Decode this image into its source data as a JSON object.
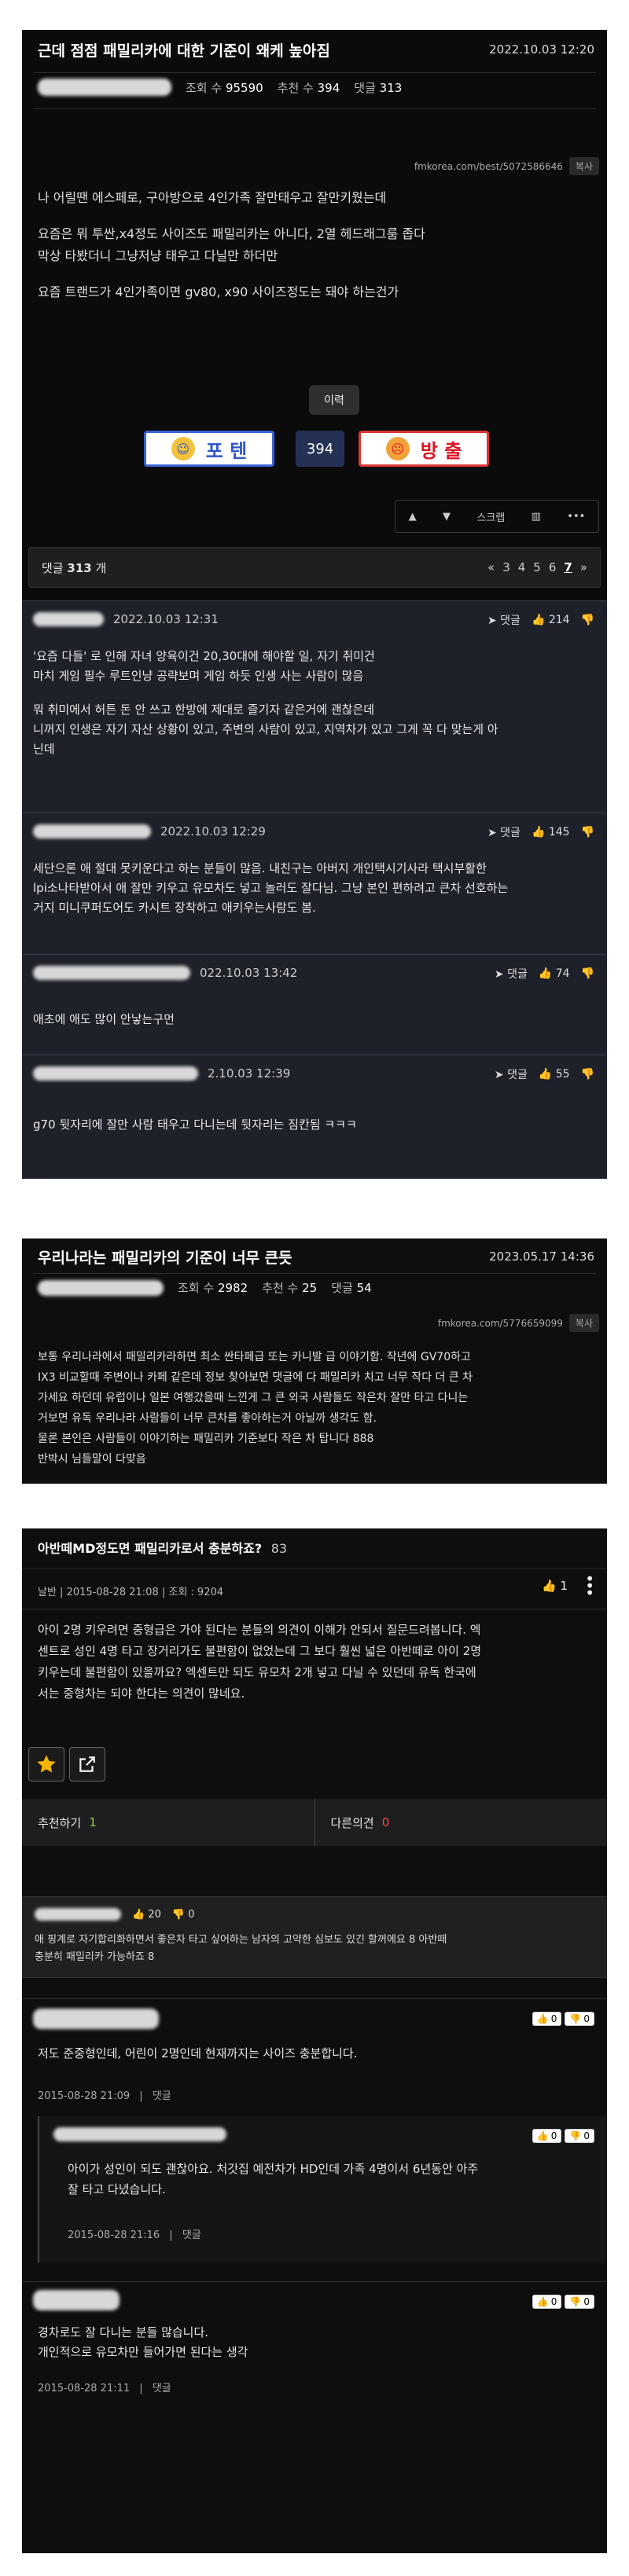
{
  "post1": {
    "title": "근데 점점 패밀리카에 대한 기준이 왜케 높아짐",
    "date": "2022.10.03 12:20",
    "views_label": "조회 수",
    "views": "95590",
    "likes_label": "추천 수",
    "likes": "394",
    "comments_label": "댓글",
    "comments": "313",
    "url": "fmkorea.com/best/5072586646",
    "copy_label": "복사",
    "body": [
      "나 어릴땐 에스페로, 구아방으로 4인가족 잘만태우고 잘만키웠는데",
      "",
      "요즘은 뭐 투싼,x4정도 사이즈도 패밀리카는 아니다, 2열 헤드래그룸 좁다",
      "막상 타봤더니 그냥저냥 태우고 다닐만 하더만",
      "",
      "요즘 트랜드가 4인가족이면 gv80, x90 사이즈정도는 돼야 하는건가"
    ],
    "history_label": "이력",
    "vote_up_label": "포 텐",
    "vote_count": "394",
    "vote_down_label": "방 출",
    "toolbar": {
      "scrap_label": "스크랩"
    },
    "comment_bar": {
      "label": "댓글",
      "count": "313",
      "unit": "개",
      "pages": [
        "3",
        "4",
        "5",
        "6",
        "7"
      ],
      "current_page": "7"
    },
    "comments_list": [
      {
        "date": "2022.10.03 12:31",
        "reply_label": "댓글",
        "likes": "214",
        "text": [
          "'요즘 다들' 로 인해 자녀 양육이건 20,30대에 해야할 일, 자기 취미건",
          "마치 게임 필수 루트인냥 공략보며 게임 하듯 인생 사는 사람이 많음",
          "",
          "뭐 취미에서 허튼 돈 안 쓰고 한방에 제대로 즐기자 같은거에 괜찮은데",
          "니꺼지 인생은 자기 자산 상황이 있고, 주변의 사람이 있고, 지역차가 있고 그게 꼭 다 맞는게 아",
          "닌데"
        ]
      },
      {
        "date": "2022.10.03 12:29",
        "reply_label": "댓글",
        "likes": "145",
        "text": [
          "세단으론 애 절대 못키운다고 하는 분들이 많음. 내친구는 아버지 개인택시기사라 택시부활한",
          "lpi소나타받아서 애 잘만 키우고 유모차도 넣고 놀러도 잘다님. 그냥 본인 편하려고 큰차 선호하는",
          "거지 미니쿠퍼도어도 카시트 장착하고 애키우는사람도 봄."
        ]
      },
      {
        "date": "022.10.03 13:42",
        "reply_label": "댓글",
        "likes": "74",
        "text": [
          "애초에 애도 많이 안낳는구먼"
        ]
      },
      {
        "date": "2.10.03 12:39",
        "reply_label": "댓글",
        "likes": "55",
        "text": [
          "g70 뒷자리에 잘만 사람 태우고 다니는데 뒷자리는 짐칸됨 ㅋㅋㅋ"
        ]
      }
    ]
  },
  "post2": {
    "title": "우리나라는 패밀리카의 기준이 너무 큰듯",
    "date": "2023.05.17 14:36",
    "views_label": "조회 수",
    "views": "2982",
    "likes_label": "추천 수",
    "likes": "25",
    "comments_label": "댓글",
    "comments": "54",
    "url": "fmkorea.com/5776659099",
    "copy_label": "복사",
    "body": [
      "보통 우리나라에서 패밀리카라하면 최소 싼타페급 또는 카니발 급 이야기함. 작년에 GV70하고",
      "IX3 비교할때 주변이나 카페 같은데 정보 찾아보면 댓글에 다 패밀리카 치고 너무 작다 더 큰 차",
      "가세요 하던데 유럽이나 일본 여행갔을때 느낀게 그 큰 외국 사람들도 작은차 잘만 타고 다니는",
      "거보면 유독 우리나라 사람들이 너무 큰차를 좋아하는거 아닐까 생각도 함.",
      "물론 본인은 사람들이 이야기하는 패밀리카 기준보다 작은 차 탑니다 888",
      "반박시 님들말이 다맞음"
    ]
  },
  "post3": {
    "title": "아반떼MD정도면 패밀리카로서 충분하죠?",
    "title_count": "83",
    "meta": "날반 | 2015-08-28 21:08 | 조회 : 9204",
    "likes": "1",
    "body": [
      "아이 2명 키우려면 중형급은 가야 된다는 분들의 의견이 이해가 안되서 질문드려봅니다. 엑",
      "센트로 성인 4명 타고 장거리가도 불편함이 없었는데 그 보다 훨씬 넓은 아반떼로 아이 2명",
      "키우는데 불편함이 있을까요? 엑센트만 되도 유모차 2개 넣고 다닐 수 있던데 유독 한국에",
      "서는 중형차는 되야 한다는 의견이 많네요."
    ],
    "recommend_label": "추천하기",
    "recommend_count": "1",
    "other_label": "다른의견",
    "other_count": "0",
    "best_comment": {
      "likes": "20",
      "dislikes": "0",
      "text": [
        "애 핑계로 자기합리화하면서 좋은차 타고 싶어하는 남자의 고약한 심보도 있긴 할꺼에요 8 아반떼",
        "충분히 패밀리카 가능하죠 8"
      ]
    },
    "replies": [
      {
        "likes": "0",
        "dislikes": "0",
        "text": [
          "저도 준중형인데, 어린이 2명인데 현재까지는 사이즈 충분합니다."
        ],
        "date": "2015-08-28 21:09",
        "reply_label": "댓글"
      },
      {
        "likes": "0",
        "dislikes": "0",
        "text": [
          "아이가 성인이 되도 괜찮아요. 처갓집 예전차가 HD인데 가족 4명이서 6년동안 아주",
          "잘 타고 다녔습니다."
        ],
        "date": "2015-08-28 21:16",
        "reply_label": "댓글"
      },
      {
        "likes": "0",
        "dislikes": "0",
        "text": [
          "경차로도 잘 다니는 분들 많습니다.",
          "개인적으로 유모차만 들어가면 된다는 생각"
        ],
        "date": "2015-08-28 21:11",
        "reply_label": "댓글"
      }
    ]
  }
}
